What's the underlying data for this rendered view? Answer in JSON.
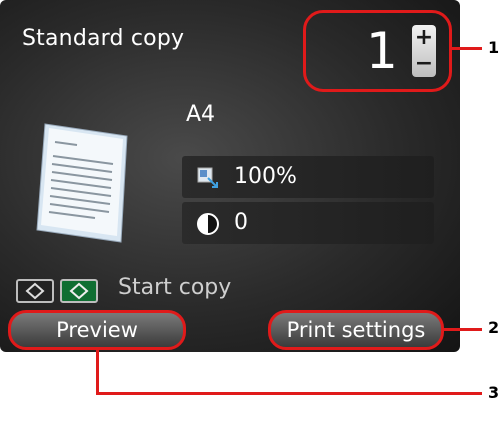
{
  "screen": {
    "title": "Standard copy",
    "copies": "1",
    "stepper": {
      "plus": "+",
      "minus": "−"
    },
    "paper_size": "A4",
    "settings": [
      {
        "icon": "magnification-icon",
        "value": "100%"
      },
      {
        "icon": "contrast-icon",
        "value": "0"
      }
    ],
    "start_hint": "Start copy",
    "buttons": {
      "preview": "Preview",
      "print_settings": "Print settings"
    }
  },
  "callouts": [
    "1",
    "2",
    "3"
  ],
  "colors": {
    "highlight": "#e01a1a",
    "screen_bg": "#2a2a2a",
    "color_key": "#0f6e32"
  }
}
